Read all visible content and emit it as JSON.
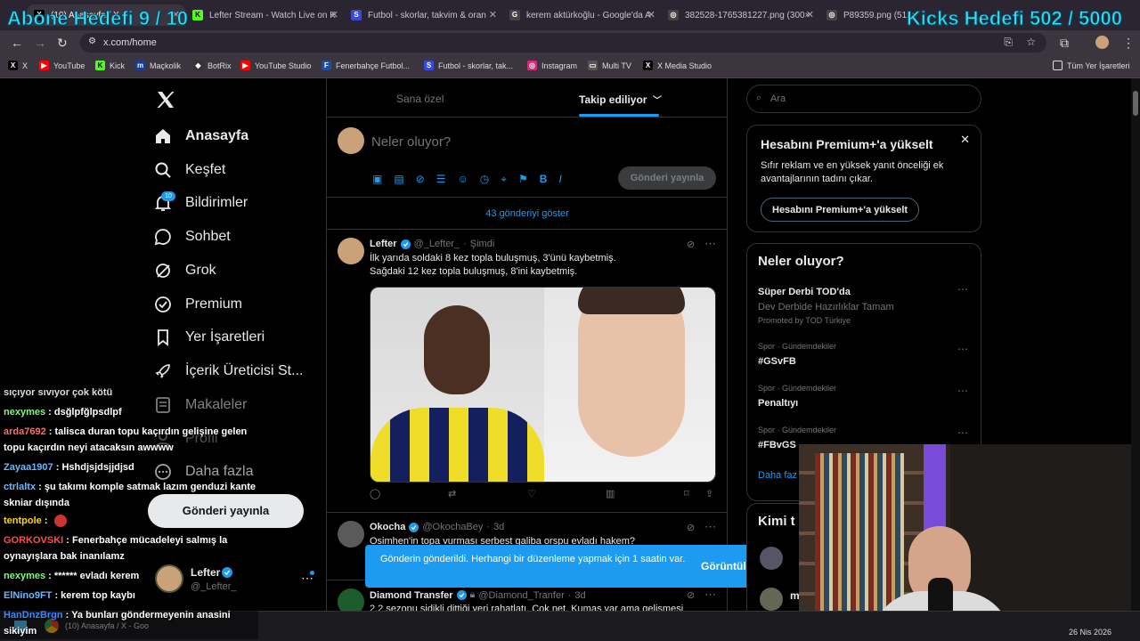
{
  "overlay": {
    "left": "Abone Hedefi 9 / 10",
    "right": "Kicks Hedefi 502 / 5000"
  },
  "browser": {
    "tabs": [
      {
        "label": "(10) Anasayfa / X",
        "fav": "X",
        "color": "#000"
      },
      {
        "label": "Lefter Stream - Watch Live on K",
        "fav": "K",
        "color": "#53fc18"
      },
      {
        "label": "Futbol - skorlar, takvim & oran",
        "fav": "S",
        "color": "#3a4ad8"
      },
      {
        "label": "kerem aktürkoğlu - Google'da A",
        "fav": "G",
        "color": "#444"
      },
      {
        "label": "382528-1765381227.png (300×",
        "fav": "◎",
        "color": "#444"
      },
      {
        "label": "P89359.png (512×512)",
        "fav": "◎",
        "color": "#444"
      }
    ],
    "url": "x.com/home",
    "bookmarks": [
      {
        "label": "X",
        "fav": "X",
        "color": "#000"
      },
      {
        "label": "YouTube",
        "fav": "▶",
        "color": "#f00"
      },
      {
        "label": "Kick",
        "fav": "K",
        "color": "#53fc18"
      },
      {
        "label": "Maçkolik",
        "fav": "m",
        "color": "#1d3c8f"
      },
      {
        "label": "BotRix",
        "fav": "◆",
        "color": "#333"
      },
      {
        "label": "YouTube Studio",
        "fav": "▶",
        "color": "#f00"
      },
      {
        "label": "Fenerbahçe Futbol...",
        "fav": "F",
        "color": "#1d4fa0"
      },
      {
        "label": "Futbol - skorlar, tak...",
        "fav": "S",
        "color": "#3a4ad8"
      },
      {
        "label": "Instagram",
        "fav": "◎",
        "color": "#d62976"
      },
      {
        "label": "Multi TV",
        "fav": "▭",
        "color": "#555"
      },
      {
        "label": "X Media Studio",
        "fav": "X",
        "color": "#000"
      }
    ],
    "all_bookmarks": "Tüm Yer İşaretleri"
  },
  "nav": {
    "items": [
      "Anasayfa",
      "Keşfet",
      "Bildirimler",
      "Sohbet",
      "Grok",
      "Premium",
      "Yer İşaretleri",
      "İçerik Üreticisi St...",
      "Makaleler",
      "Profil",
      "Daha fazla"
    ],
    "badge": "10",
    "post_button": "Gönderi yayınla",
    "account": {
      "name": "Lefter",
      "handle": "@_Lefter_"
    }
  },
  "feed": {
    "tabs": [
      "Sana özel",
      "Takip ediliyor"
    ],
    "compose_placeholder": "Neler oluyor?",
    "compose_button": "Gönderi yayınla",
    "show_more": "43 gönderiyi göster",
    "posts": [
      {
        "name": "Lefter",
        "handle": "@_Lefter_",
        "time": "Şimdi",
        "line1": "İlk yarıda soldaki 8 kez topla buluşmuş, 3'ünü kaybetmiş.",
        "line2": "Sağdaki 12 kez topla buluşmuş, 8'ini kaybetmiş."
      },
      {
        "name": "Okocha",
        "handle": "@OkochaBey",
        "time": "3d",
        "line1": "Osimhen'in topa vurması serbest galiba orspu evladı hakem?"
      },
      {
        "name": "Diamond Transfer",
        "handle": "@Diamond_Tranfer",
        "time": "3d",
        "line1": "2,2 sezonu sidikli dittiği yeri rahatlatı. Çok net. Kumas var ama gelişmesi"
      }
    ]
  },
  "toast": {
    "message": "Gönderin gönderildi. Herhangi bir düzenleme yapmak için 1 saatin var.",
    "action": "Görüntüle"
  },
  "sidebar": {
    "search_placeholder": "Ara",
    "premium": {
      "title": "Hesabını Premium+'a yükselt",
      "body": "Sıfır reklam ve en yüksek yanıt önceliği ek avantajlarının tadını çıkar.",
      "button": "Hesabını Premium+'a yükselt"
    },
    "trends_title": "Neler oluyor?",
    "trends": [
      {
        "meta": "",
        "name": "Süper Derbi TOD'da",
        "sub": "Dev Derbide Hazırlıklar Tamam",
        "promo": "Promoted by TOD Türkiye"
      },
      {
        "meta": "Spor · Gündemdekiler",
        "name": "#GSvFB"
      },
      {
        "meta": "Spor · Gündemdekiler",
        "name": "Penaltıyı"
      },
      {
        "meta": "Spor · Gündemdekiler",
        "name": "#FBvGS"
      }
    ],
    "more": "Daha faz",
    "who_title": "Kimi t",
    "who_initial": "m"
  },
  "chat": [
    {
      "user": "",
      "msg": "sıçıyor sıvıyor çok kötü",
      "color": "#fff"
    },
    {
      "user": "nexymes",
      "msg": "dsğlpfğlpsdlpf",
      "color": "#7cfc7c"
    },
    {
      "user": "arda7692",
      "msg": "talisca duran topu kaçırdın gelişine gelen topu kaçırdın neyi atacaksın awwww",
      "color": "#ff6b6b"
    },
    {
      "user": "Zayaa1907",
      "msg": "Hshdjsjdsjjdjsd",
      "color": "#6ab7ff"
    },
    {
      "user": "ctrlaltx",
      "msg": "şu takımı komple satmak lazım genduzi kante skniar dışında",
      "color": "#6ab7ff"
    },
    {
      "user": "tentpole",
      "msg": "",
      "color": "#ffd700"
    },
    {
      "user": "GORKOVSKI",
      "msg": "Fenerbahçe mücadeleyi salmış la oynayışlara bak inanılamz",
      "color": "#ff4d4d"
    },
    {
      "user": "nexymes",
      "msg": "****** evladı kerem",
      "color": "#7cfc7c"
    },
    {
      "user": "ElNino9FT",
      "msg": "kerem top kaybı",
      "color": "#6ab7ff"
    },
    {
      "user": "HanDnzBrgn",
      "msg": "Ya bunları göndermeyenin anasini sikiyim",
      "color": "#3a8bff"
    }
  ],
  "taskbar": {
    "app": "(10) Anasayfa / X - Goo",
    "date": "26 Nis 2026"
  }
}
